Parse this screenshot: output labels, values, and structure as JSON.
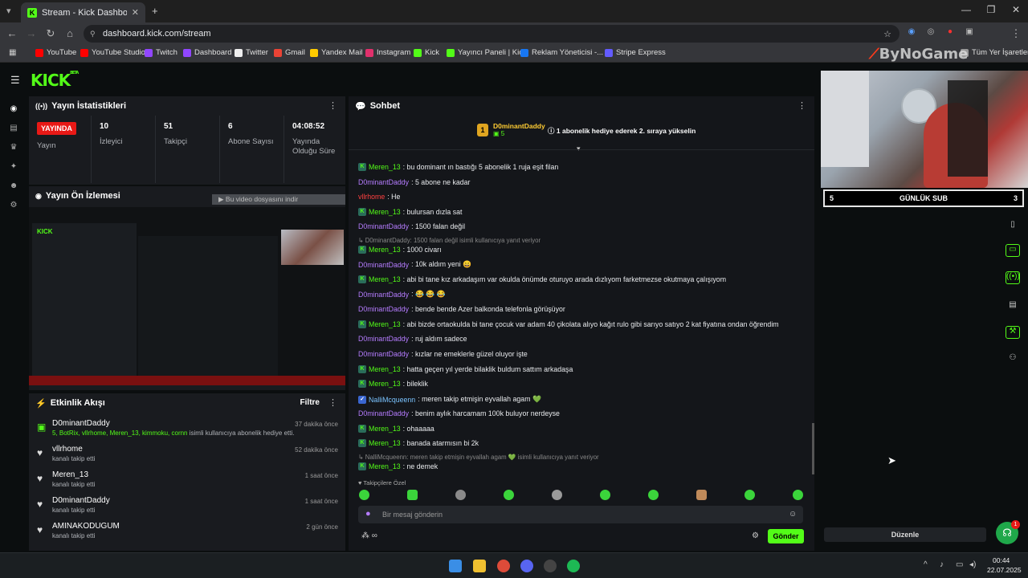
{
  "browser": {
    "tab_title": "Stream - Kick Dashboard",
    "url": "dashboard.kick.com/stream",
    "bookmarks": [
      "YouTube",
      "YouTube Studio",
      "Twitch",
      "Dashboard",
      "Twitter",
      "Gmail",
      "Yandex Mail",
      "Instagram",
      "Kick",
      "Yayıncı Paneli | Kick",
      "Reklam Yöneticisi -...",
      "Stripe Express"
    ],
    "all_bookmarks": "Tüm Yer İşaretleri",
    "watermark": "ByNoGame"
  },
  "stats": {
    "title": "Yayın İstatistikleri",
    "live_badge": "YAYINDA",
    "broadcast_label": "Yayın",
    "viewers": "10",
    "viewers_label": "İzleyici",
    "followers": "51",
    "followers_label": "Takipçi",
    "subs": "6",
    "subs_label": "Abone Sayısı",
    "uptime": "04:08:52",
    "uptime_label": "Yayında Olduğu Süre"
  },
  "preview": {
    "title": "Yayın Ön İzlemesi",
    "hint": "Bu video dosyasını indir"
  },
  "activity": {
    "title": "Etkinlik Akışı",
    "filter": "Filtre",
    "items": [
      {
        "name": "D0minantDaddy",
        "sub": "5, BotRix, vllrhome, Meren_13, kimmoku, cornn",
        "sub_suffix": " isimli kullanıcıya abonelik hediye etti.",
        "time": "37 dakika önce"
      },
      {
        "name": "vllrhome",
        "sub": "kanalı takip etti",
        "time": "52 dakika önce"
      },
      {
        "name": "Meren_13",
        "sub": "kanalı takip etti",
        "time": "1 saat önce"
      },
      {
        "name": "D0minantDaddy",
        "sub": "kanalı takip etti",
        "time": "1 saat önce"
      },
      {
        "name": "AMINAKODUGUM",
        "sub": "kanalı takip etti",
        "time": "2 gün önce"
      }
    ]
  },
  "chat": {
    "title": "Sohbet",
    "pinned_user": "D0minantDaddy",
    "pinned_count": "5",
    "pinned_rank": "1",
    "pinned_promo": "1 abonelik hediye ederek 2. sıraya yükselin",
    "messages": [
      {
        "user": "Meren_13",
        "text": ": bu dominant ın bastığı 5 abonelik 1 ruja eşit filan"
      },
      {
        "user": "D0minantDaddy",
        "text": ": 5 abone ne kadar"
      },
      {
        "user": "vllrhome",
        "text": ": He"
      },
      {
        "user": "Meren_13",
        "text": ": bulursan dızla sat"
      },
      {
        "user": "D0minantDaddy",
        "text": ": 1500 falan değil"
      },
      {
        "reply": "↳ D0minantDaddy: 1500 falan değil isimli kullanıcıya yanıt veriyor"
      },
      {
        "user": "Meren_13",
        "text": ": 1000 civarı"
      },
      {
        "user": "D0minantDaddy",
        "text": ": 10k aldım yeni 😄"
      },
      {
        "user": "Meren_13",
        "text": ": abi bi tane kız arkadaşım var okulda önümde oturuyo arada dızlıyom farketmezse okutmaya çalışıyom"
      },
      {
        "user": "D0minantDaddy",
        "text": ": 😂 😂 😂"
      },
      {
        "user": "D0minantDaddy",
        "text": ": bende bende Azer balkonda telefonla görüşüyor"
      },
      {
        "user": "Meren_13",
        "text": ": abi bizde ortaokulda bi tane çocuk var adam 40 çikolata alıyo kağıt rulo gibi sarıyo satıyo 2 kat fiyatına ondan öğrendim"
      },
      {
        "user": "D0minantDaddy",
        "text": ": ruj aldım sadece"
      },
      {
        "user": "D0minantDaddy",
        "text": ": kızlar ne emeklerle güzel oluyor işte"
      },
      {
        "user": "Meren_13",
        "text": ": hatta geçen yıl yerde bilaklik buldum sattım arkadaşa"
      },
      {
        "user": "Meren_13",
        "text": ": bileklik"
      },
      {
        "user": "NalliMcqueenn",
        "text": ": meren takip etmişin eyvallah agam 💚"
      },
      {
        "user": "D0minantDaddy",
        "text": ": benim aylık harcamam 100k buluyor nerdeyse"
      },
      {
        "user": "Meren_13",
        "text": ": ohaaaaa"
      },
      {
        "user": "Meren_13",
        "text": ": banada atarmısın bi 2k"
      },
      {
        "reply": "↳ NalliMcqueenn: meren takip etmişin eyvallah agam 💚 isimli kullanıcıya yanıt veriyor"
      },
      {
        "user": "Meren_13",
        "text": ": ne demek"
      }
    ],
    "followers_only": "Takipçilere Özel",
    "input_placeholder": "Bir mesaj gönderin",
    "send": "Gönder"
  },
  "overlay": {
    "sub_left": "5",
    "sub_title": "GÜNLÜK SUB",
    "sub_right": "3",
    "edit_button": "Düzenle",
    "help_badge": "1"
  },
  "taskbar": {
    "time": "00:44",
    "date": "22.07.2025"
  }
}
